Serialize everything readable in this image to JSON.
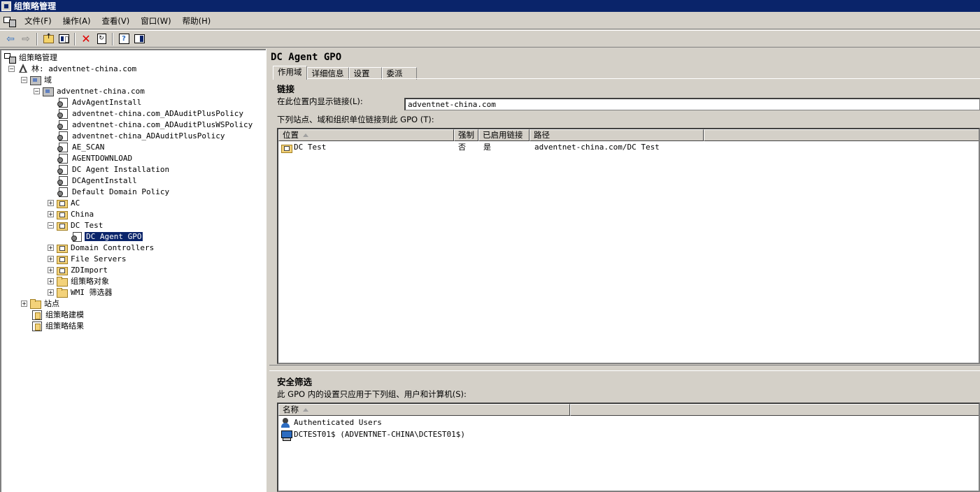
{
  "window": {
    "title": "组策略管理"
  },
  "menu": [
    "文件(F)",
    "操作(A)",
    "查看(V)",
    "窗口(W)",
    "帮助(H)"
  ],
  "toolbar": {
    "buttons": [
      "back-icon",
      "forward-icon",
      "up-folder-icon",
      "show-tree-icon",
      "delete-icon",
      "refresh-icon",
      "help-icon",
      "action-pane-icon"
    ]
  },
  "tree": {
    "root": "组策略管理",
    "forest": "林: adventnet-china.com",
    "domains": "域",
    "domain": "adventnet-china.com",
    "gpo_links": [
      "AdvAgentInstall",
      "adventnet-china.com_ADAuditPlusPolicy",
      "adventnet-china.com_ADAuditPlusWSPolicy",
      "adventnet-china_ADAuditPlusPolicy",
      "AE_SCAN",
      "AGENTDOWNLOAD",
      "DC Agent Installation",
      "DCAgentInstall",
      "Default Domain Policy"
    ],
    "ou_ac": "AC",
    "ou_china": "China",
    "ou_dctest": "DC Test",
    "selected_gpo": "DC Agent GPO",
    "ou_dc": "Domain Controllers",
    "ou_fileservers": "File Servers",
    "ou_zdimport": "ZDImport",
    "gpo_objects": "组策略对象",
    "wmi_filters": "WMI 筛选器",
    "sites": "站点",
    "modeling": "组策略建模",
    "results": "组策略结果"
  },
  "detail": {
    "title": "DC Agent GPO",
    "tabs": [
      "作用域",
      "详细信息",
      "设置",
      "委派"
    ],
    "links_section": "链接",
    "show_links_label": "在此位置内显示链接(L):",
    "show_links_value": "adventnet-china.com",
    "links_list_label": "下列站点、域和组织单位链接到此 GPO (T):",
    "links_columns": [
      "位置",
      "强制",
      "已启用链接",
      "路径"
    ],
    "links_rows": [
      {
        "location": "DC Test",
        "enforced": "否",
        "enabled": "是",
        "path": "adventnet-china.com/DC Test"
      }
    ],
    "security_section": "安全筛选",
    "security_label": "此 GPO 内的设置只应用于下列组、用户和计算机(S):",
    "security_columns": [
      "名称"
    ],
    "security_rows": [
      {
        "name": "Authenticated Users",
        "icon": "users-icon"
      },
      {
        "name": "DCTEST01$ (ADVENTNET-CHINA\\DCTEST01$)",
        "icon": "computer-icon"
      }
    ]
  }
}
